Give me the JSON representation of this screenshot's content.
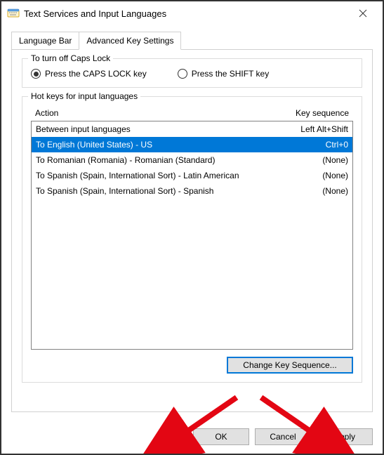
{
  "window": {
    "title": "Text Services and Input Languages"
  },
  "tabs": {
    "language_bar": "Language Bar",
    "advanced": "Advanced Key Settings"
  },
  "caps_group": {
    "title": "To turn off Caps Lock",
    "opt_caps": "Press the CAPS LOCK key",
    "opt_shift": "Press the SHIFT key"
  },
  "hotkeys_group": {
    "title": "Hot keys for input languages",
    "col_action": "Action",
    "col_key": "Key sequence",
    "rows": [
      {
        "action": "Between input languages",
        "key": "Left Alt+Shift",
        "selected": false
      },
      {
        "action": "To English (United States) - US",
        "key": "Ctrl+0",
        "selected": true
      },
      {
        "action": "To Romanian (Romania) - Romanian (Standard)",
        "key": "(None)",
        "selected": false
      },
      {
        "action": "To Spanish (Spain, International Sort) - Latin American",
        "key": "(None)",
        "selected": false
      },
      {
        "action": "To Spanish (Spain, International Sort) - Spanish",
        "key": "(None)",
        "selected": false
      }
    ],
    "change_btn": "Change Key Sequence..."
  },
  "footer": {
    "ok": "OK",
    "cancel": "Cancel",
    "apply": "Apply"
  }
}
